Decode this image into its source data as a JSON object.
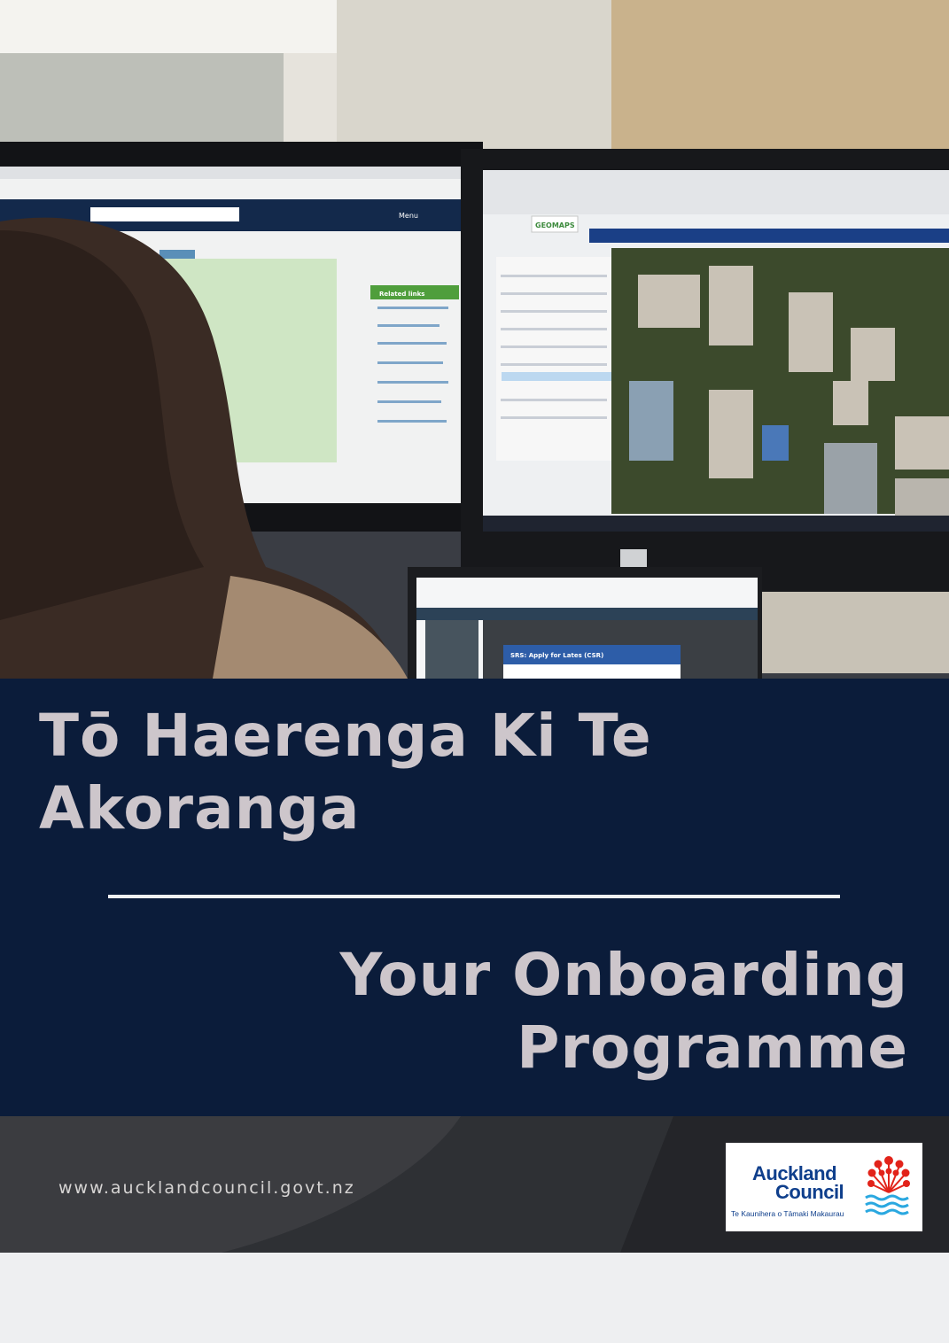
{
  "cover": {
    "title_maori": "Tō Haerenga Ki Te Akoranga",
    "title_english": "Your Onboarding Programme",
    "website": "www.aucklandcouncil.govt.nz"
  },
  "logo": {
    "name_line1": "Auckland",
    "name_line2": "Council",
    "tagline": "Te Kaunihera o Tāmaki Makaurau",
    "emblem_icon": "pohutukawa-flower-icon",
    "waves_icon": "water-waves-icon"
  },
  "photo": {
    "screen_app_badge": "GEOMAPS",
    "screen_related_links_heading": "Related links",
    "screen_menu_label": "Menu",
    "laptop_panel_heading": "SRS: Apply for Lates (CSR)"
  },
  "colors": {
    "band": "#0b1c3a",
    "title_text": "#cdc6cb",
    "logo_blue": "#0f3f8c",
    "logo_red": "#e2231a",
    "logo_wave": "#2aa8e0"
  }
}
